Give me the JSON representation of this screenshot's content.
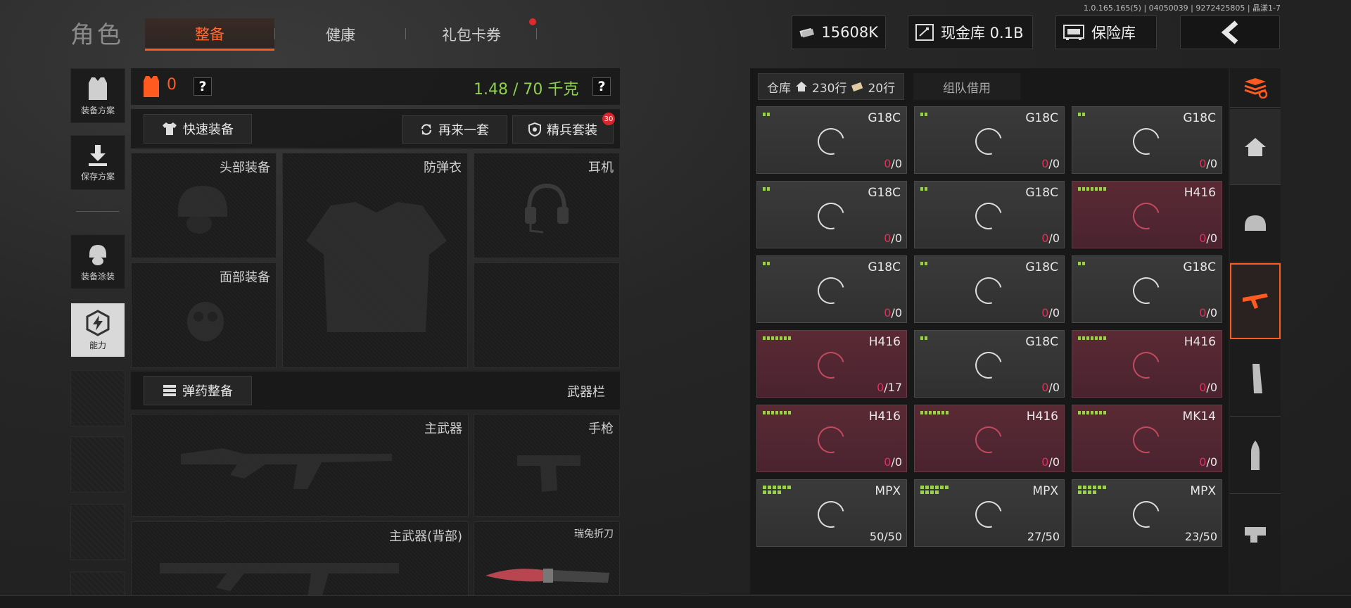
{
  "version": "1.0.165.165(5) | 04050039 | 9272425805 | 晶漾1-7",
  "title": "角色",
  "tabs": [
    {
      "label": "整备",
      "active": true
    },
    {
      "label": "健康",
      "active": false
    },
    {
      "label": "礼包卡券",
      "active": false
    }
  ],
  "hud": {
    "cash": "15608K",
    "cash_vault": "现金库 0.1B",
    "safe": "保险库"
  },
  "sidebar": {
    "items": [
      {
        "label": "装备方案",
        "icon": "vest-icon"
      },
      {
        "label": "保存方案",
        "icon": "download-icon"
      },
      {
        "label": "装备涂装",
        "icon": "helmet-paint-icon"
      },
      {
        "label": "能力",
        "icon": "ability-icon"
      }
    ]
  },
  "loadout": {
    "vest_count": "0",
    "weight": "1.48 / 70 千克",
    "quick_equip": "快速装备",
    "again": "再来一套",
    "elite": "精兵套装",
    "elite_badge": "30",
    "slots": {
      "head": "头部装备",
      "armor": "防弹衣",
      "headset": "耳机",
      "face": "面部装备",
      "ammo_btn": "弹药整备",
      "weapon_bar": "武器栏",
      "primary": "主武器",
      "pistol": "手枪",
      "primary_back": "主武器(背部)",
      "knife": "瑞兔折刀"
    }
  },
  "warehouse": {
    "tab_label": "仓库",
    "rows_home": "230行",
    "rows_ticket": "20行",
    "team_tab": "组队借用",
    "items": [
      {
        "name": "G18C",
        "count_a": "0",
        "count_b": "/0",
        "red": false,
        "pips": 2
      },
      {
        "name": "G18C",
        "count_a": "0",
        "count_b": "/0",
        "red": false,
        "pips": 2
      },
      {
        "name": "G18C",
        "count_a": "0",
        "count_b": "/0",
        "red": false,
        "pips": 2
      },
      {
        "name": "G18C",
        "count_a": "0",
        "count_b": "/0",
        "red": false,
        "pips": 2
      },
      {
        "name": "G18C",
        "count_a": "0",
        "count_b": "/0",
        "red": false,
        "pips": 2
      },
      {
        "name": "H416",
        "count_a": "0",
        "count_b": "/0",
        "red": true,
        "pips": 7
      },
      {
        "name": "G18C",
        "count_a": "0",
        "count_b": "/0",
        "red": false,
        "pips": 2
      },
      {
        "name": "G18C",
        "count_a": "0",
        "count_b": "/0",
        "red": false,
        "pips": 2
      },
      {
        "name": "G18C",
        "count_a": "0",
        "count_b": "/0",
        "red": false,
        "pips": 2
      },
      {
        "name": "H416",
        "count_a": "0",
        "count_b": "/17",
        "red": true,
        "pips": 7
      },
      {
        "name": "G18C",
        "count_a": "0",
        "count_b": "/0",
        "red": false,
        "pips": 2
      },
      {
        "name": "H416",
        "count_a": "0",
        "count_b": "/0",
        "red": true,
        "pips": 7
      },
      {
        "name": "H416",
        "count_a": "0",
        "count_b": "/0",
        "red": true,
        "pips": 7
      },
      {
        "name": "H416",
        "count_a": "0",
        "count_b": "/0",
        "red": true,
        "pips": 7
      },
      {
        "name": "MK14",
        "count_a": "0",
        "count_b": "/0",
        "red": true,
        "pips": 7
      },
      {
        "name": "MPX",
        "count_a": "50/50",
        "count_b": "",
        "red": false,
        "pips": 10
      },
      {
        "name": "MPX",
        "count_a": "27/50",
        "count_b": "",
        "red": false,
        "pips": 10
      },
      {
        "name": "MPX",
        "count_a": "23/50",
        "count_b": "",
        "red": false,
        "pips": 10
      }
    ]
  },
  "right_tabs": [
    "stack-icon",
    "home-icon",
    "helmet-icon",
    "gun-icon",
    "magazine-icon",
    "bullet-icon",
    "scope-icon"
  ],
  "colors": {
    "accent": "#ff5a1f",
    "weight_green": "#8fd14f",
    "danger": "#e0305a"
  }
}
